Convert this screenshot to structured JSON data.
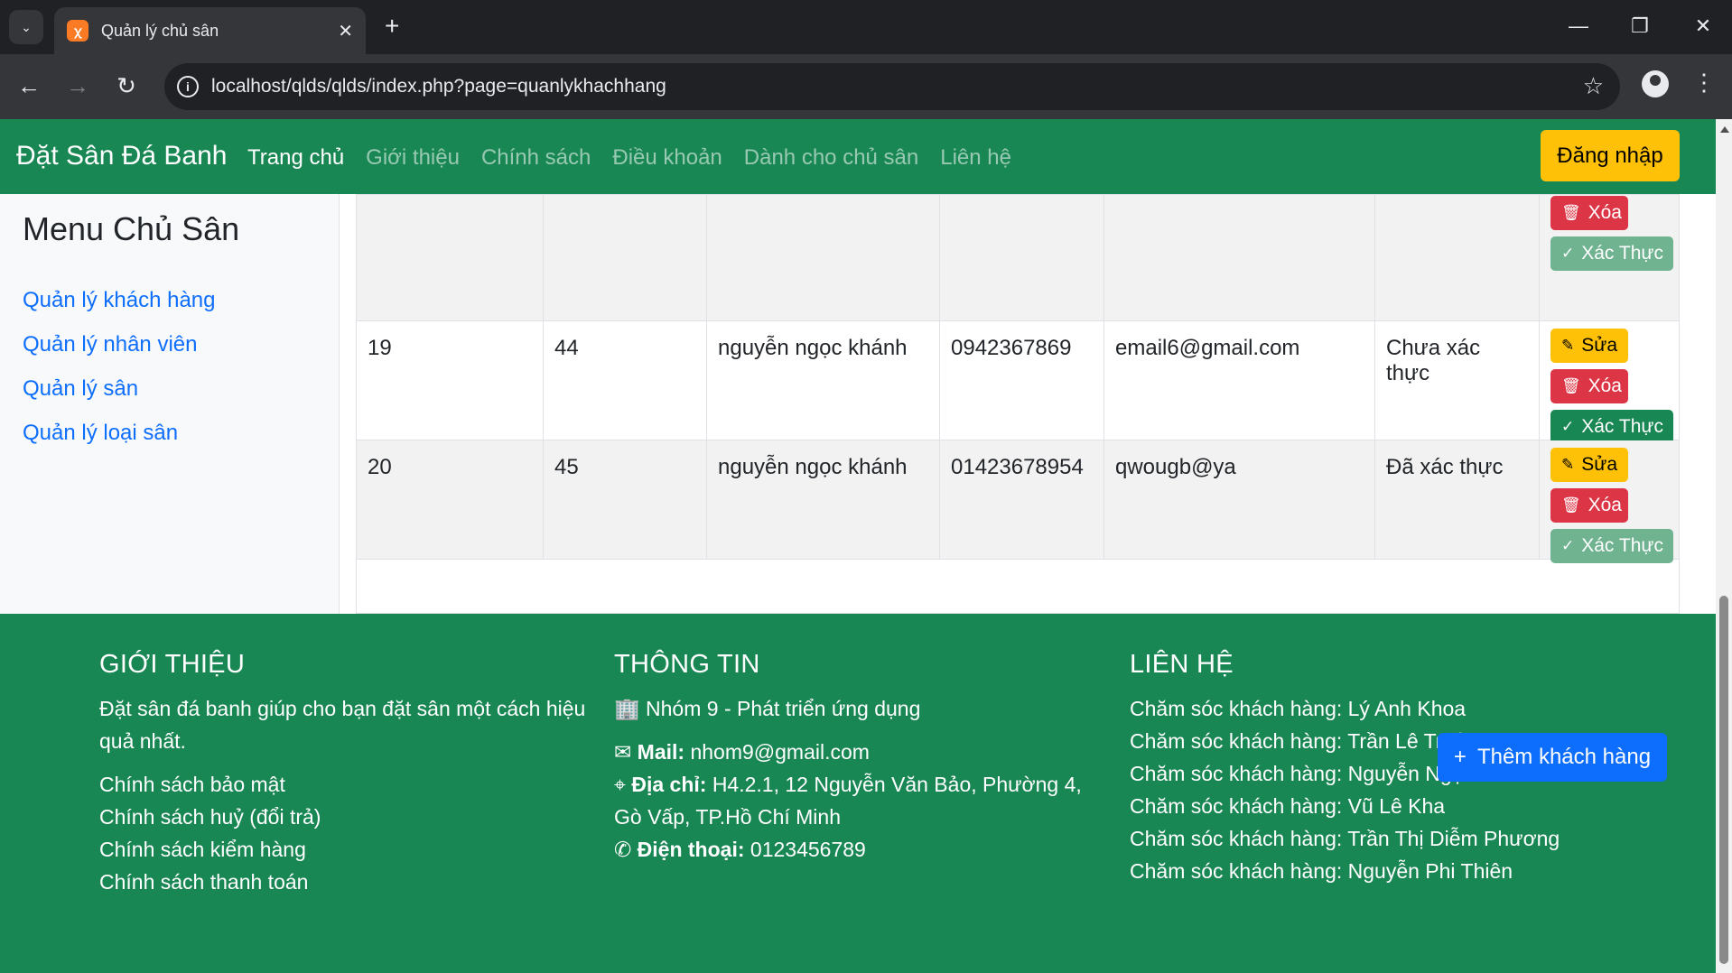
{
  "browser": {
    "tab_title": "Quản lý chủ sân",
    "url": "localhost/qlds/qlds/index.php?page=quanlykhachhang"
  },
  "navbar": {
    "brand": "Đặt Sân Đá Banh",
    "links": [
      "Trang chủ",
      "Giới thiệu",
      "Chính sách",
      "Điều khoản",
      "Dành cho chủ sân",
      "Liên hệ"
    ],
    "login": "Đăng nhập"
  },
  "sidebar": {
    "title": "Menu Chủ Sân",
    "items": [
      "Quản lý khách hàng",
      "Quản lý nhân viên",
      "Quản lý sân",
      "Quản lý loại sân"
    ]
  },
  "table": {
    "actions": {
      "edit": "Sửa",
      "delete": "Xóa",
      "verify": "Xác Thực"
    },
    "rows": [
      {
        "c1": "",
        "c2": "",
        "c3": "",
        "c4": "",
        "c5": "",
        "c6": ""
      },
      {
        "c1": "19",
        "c2": "44",
        "c3": "nguyễn ngọc khánh",
        "c4": "0942367869",
        "c5": "email6@gmail.com",
        "c6": "Chưa xác thực"
      },
      {
        "c1": "20",
        "c2": "45",
        "c3": "nguyễn ngọc khánh",
        "c4": "01423678954",
        "c5": "qwougb@ya",
        "c6": "Đã xác thực"
      }
    ]
  },
  "footer": {
    "intro": {
      "heading": "GIỚI THIỆU",
      "text": "Đặt sân đá banh giúp cho bạn đặt sân một cách hiệu quả nhất.",
      "links": [
        "Chính sách bảo mật",
        "Chính sách huỷ (đổi trả)",
        "Chính sách kiểm hàng",
        "Chính sách thanh toán"
      ]
    },
    "info": {
      "heading": "THÔNG TIN",
      "group": "Nhóm 9 - Phát triển ứng dụng",
      "mail_label": "Mail:",
      "mail": "nhom9@gmail.com",
      "address_label": "Địa chỉ:",
      "address": "H4.2.1, 12 Nguyễn Văn Bảo, Phường 4, Gò Vấp, TP.Hồ Chí Minh",
      "phone_label": "Điện thoại:",
      "phone": "0123456789"
    },
    "contact": {
      "heading": "LIÊN HỆ",
      "people": [
        "Chăm sóc khách hàng: Lý Anh Khoa",
        "Chăm sóc khách hàng: Trần Lê Trường Vũ",
        "Chăm sóc khách hàng: Nguyễn Ngọc Khánh",
        "Chăm sóc khách hàng: Vũ Lê Kha",
        "Chăm sóc khách hàng: Trần Thị Diễm Phương",
        "Chăm sóc khách hàng: Nguyễn Phi Thiên"
      ]
    }
  },
  "add_button": "Thêm khách hàng",
  "colors": {
    "navbar": "#198754",
    "login": "#ffc107",
    "danger": "#dc3545",
    "primary": "#0d6efd"
  }
}
